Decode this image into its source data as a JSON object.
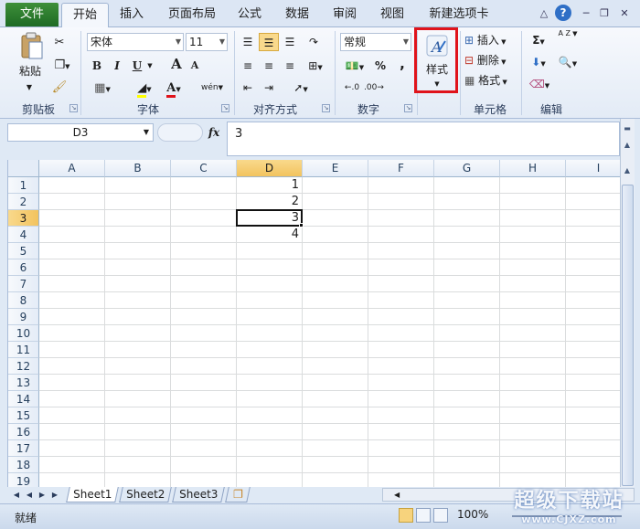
{
  "tabs": {
    "file": "文件",
    "items": [
      "开始",
      "插入",
      "页面布局",
      "公式",
      "数据",
      "审阅",
      "视图",
      "新建选项卡"
    ]
  },
  "ribbon": {
    "clipboard": {
      "paste": "粘贴",
      "label": "剪贴板"
    },
    "font": {
      "name": "宋体",
      "size": "11",
      "bold": "B",
      "italic": "I",
      "underline": "U",
      "grow": "A",
      "shrink": "A",
      "color": "A",
      "phonetic": "wén",
      "label": "字体"
    },
    "alignment": {
      "label": "对齐方式"
    },
    "number": {
      "format": "常规",
      "percent": "%",
      "comma": ",",
      "label": "数字"
    },
    "styles": {
      "button": "样式"
    },
    "cells": {
      "insert": "插入",
      "delete": "删除",
      "format": "格式",
      "label": "单元格"
    },
    "editing": {
      "sum": "Σ",
      "sort": "A Z",
      "label": "编辑"
    }
  },
  "formula_bar": {
    "name_box": "D3",
    "fx": "fx",
    "content": "3"
  },
  "grid": {
    "columns": [
      "A",
      "B",
      "C",
      "D",
      "E",
      "F",
      "G",
      "H",
      "I"
    ],
    "active_column": "D",
    "rows": [
      "1",
      "2",
      "3",
      "4",
      "5",
      "6",
      "7",
      "8",
      "9",
      "10",
      "11",
      "12",
      "13",
      "14",
      "15",
      "16",
      "17",
      "18",
      "19"
    ],
    "active_row": "3",
    "cells": [
      {
        "ref": "D1",
        "value": "1"
      },
      {
        "ref": "D2",
        "value": "2"
      },
      {
        "ref": "D3",
        "value": "3"
      },
      {
        "ref": "D4",
        "value": "4"
      }
    ]
  },
  "sheets": [
    "Sheet1",
    "Sheet2",
    "Sheet3"
  ],
  "active_sheet": "Sheet1",
  "status": {
    "ready": "就绪",
    "zoom": "100%"
  },
  "watermark": {
    "title": "超级下载站",
    "url": "www.CJXZ.com"
  },
  "colors": {
    "file_tab": "#2a7d2e",
    "highlight": "#e0131b",
    "active_header": "#f2c35e"
  }
}
